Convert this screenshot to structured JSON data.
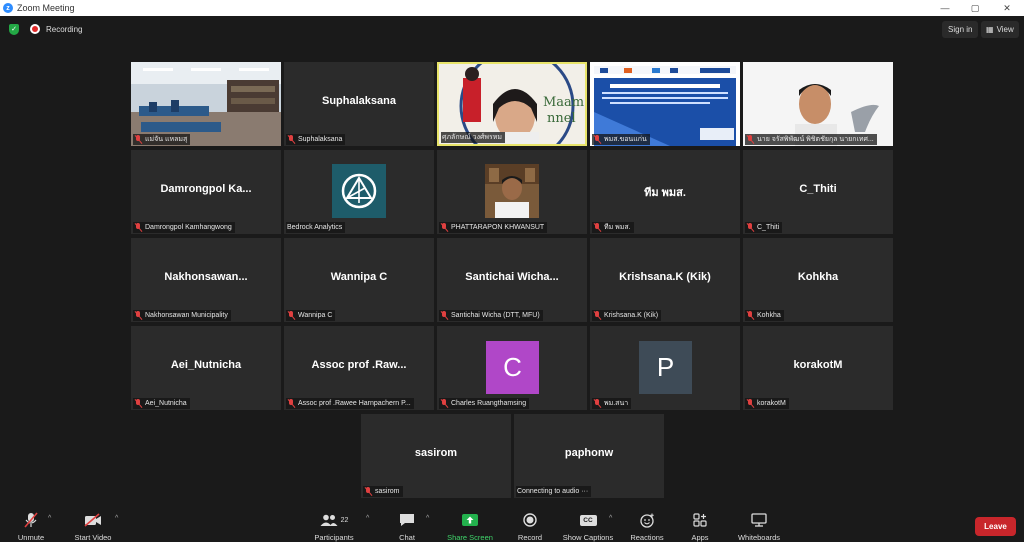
{
  "window": {
    "title": "Zoom Meeting"
  },
  "topbar": {
    "recording": "Recording",
    "sign_in": "Sign in",
    "view": "View"
  },
  "tiles": [
    {
      "big": "",
      "name": "แม่จัน แหลมสุ",
      "muted": true,
      "kind": "video-classroom"
    },
    {
      "big": "Suphalaksana",
      "name": "Suphalaksana",
      "muted": true,
      "kind": "text"
    },
    {
      "big": "",
      "name": "ศุภลักษณ์ วงศ์พรหม",
      "muted": false,
      "kind": "video-speaker",
      "overlay": "Maam nnel"
    },
    {
      "big": "",
      "name": "พมส.ขอนแก่น",
      "muted": true,
      "kind": "video-slide"
    },
    {
      "big": "",
      "name": "นาย จรัสพิพัฒน์ พิชิตชัยกุล นายกเทศ...",
      "muted": true,
      "kind": "video-person"
    },
    {
      "big": "Damrongpol Ka...",
      "name": "Damrongpol Kamhangwong",
      "muted": true,
      "kind": "text"
    },
    {
      "big": "",
      "name": "Bedrock Analytics",
      "muted": false,
      "kind": "logo"
    },
    {
      "big": "",
      "name": "PHATTARAPON KHWANSUT",
      "muted": true,
      "kind": "photo"
    },
    {
      "big": "ทีม พมส.",
      "name": "ทีม พมส.",
      "muted": true,
      "kind": "text"
    },
    {
      "big": "C_Thiti",
      "name": "C_Thiti",
      "muted": true,
      "kind": "text"
    },
    {
      "big": "Nakhonsawan...",
      "name": "Nakhonsawan Municipality",
      "muted": true,
      "kind": "text"
    },
    {
      "big": "Wannipa C",
      "name": "Wannipa C",
      "muted": true,
      "kind": "text"
    },
    {
      "big": "Santichai Wicha...",
      "name": "Santichai Wicha (DTT, MFU)",
      "muted": true,
      "kind": "text"
    },
    {
      "big": "Krishsana.K (Kik)",
      "name": "Krishsana.K (Kik)",
      "muted": true,
      "kind": "text"
    },
    {
      "big": "Kohkha",
      "name": "Kohkha",
      "muted": true,
      "kind": "text"
    },
    {
      "big": "Aei_Nutnicha",
      "name": "Aei_Nutnicha",
      "muted": true,
      "kind": "text"
    },
    {
      "big": "Assoc prof .Raw...",
      "name": "Assoc prof .Rawee Harnpachern P...",
      "muted": true,
      "kind": "text"
    },
    {
      "big": "C",
      "name": "Charles Ruangthamsing",
      "muted": true,
      "kind": "avatar",
      "color": "#b047c8"
    },
    {
      "big": "P",
      "name": "พม.สนา",
      "muted": true,
      "kind": "avatar",
      "color": "#3e4b57"
    },
    {
      "big": "korakotM",
      "name": "korakotM",
      "muted": true,
      "kind": "text"
    },
    {
      "big": "sasirom",
      "name": "sasirom",
      "muted": true,
      "kind": "text"
    },
    {
      "big": "paphonw",
      "name": "Connecting to audio ···",
      "muted": false,
      "kind": "text"
    }
  ],
  "toolbar": {
    "unmute": "Unmute",
    "start_video": "Start Video",
    "participants": "Participants",
    "participants_count": "22",
    "chat": "Chat",
    "share_screen": "Share Screen",
    "record": "Record",
    "show_captions": "Show Captions",
    "captions_icon": "CC",
    "reactions": "Reactions",
    "apps": "Apps",
    "whiteboards": "Whiteboards",
    "leave": "Leave"
  },
  "colors": {
    "share_green": "#23b14d",
    "leave_red": "#c8262b",
    "speaker_border": "#e8e46a"
  }
}
